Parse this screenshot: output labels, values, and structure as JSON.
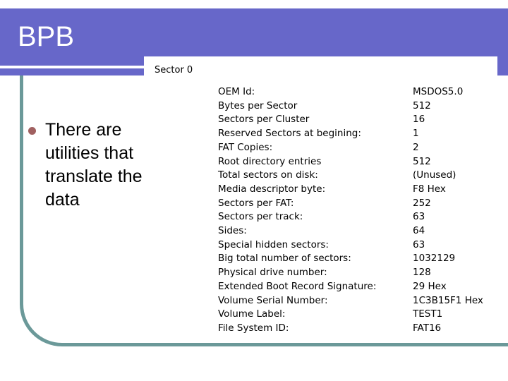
{
  "slide": {
    "title": "BPB",
    "bullets": [
      "There are utilities that translate the data"
    ],
    "colors": {
      "banner": "#6767c9",
      "frame": "#6b9999",
      "bullet": "#a06060"
    }
  },
  "inset": {
    "caption": "Sector 0",
    "rows": [
      {
        "field": "OEM Id:",
        "value": "MSDOS5.0"
      },
      {
        "field": "Bytes per Sector",
        "value": "512"
      },
      {
        "field": "Sectors per Cluster",
        "value": "16"
      },
      {
        "field": "Reserved Sectors at begining:",
        "value": "1"
      },
      {
        "field": "FAT Copies:",
        "value": "2"
      },
      {
        "field": "Root directory entries",
        "value": "512"
      },
      {
        "field": "Total sectors on disk:",
        "value": "(Unused)"
      },
      {
        "field": "Media descriptor byte:",
        "value": "F8 Hex"
      },
      {
        "field": "Sectors per FAT:",
        "value": "252"
      },
      {
        "field": "Sectors per track:",
        "value": "63"
      },
      {
        "field": "Sides:",
        "value": "64"
      },
      {
        "field": "Special hidden sectors:",
        "value": "63"
      },
      {
        "field": "Big total number of sectors:",
        "value": "1032129"
      },
      {
        "field": "Physical drive number:",
        "value": "128"
      },
      {
        "field": "Extended Boot Record Signature:",
        "value": "29 Hex"
      },
      {
        "field": "Volume Serial Number:",
        "value": "1C3B15F1 Hex"
      },
      {
        "field": "Volume Label:",
        "value": "TEST1"
      },
      {
        "field": "File System ID:",
        "value": "FAT16"
      }
    ]
  }
}
